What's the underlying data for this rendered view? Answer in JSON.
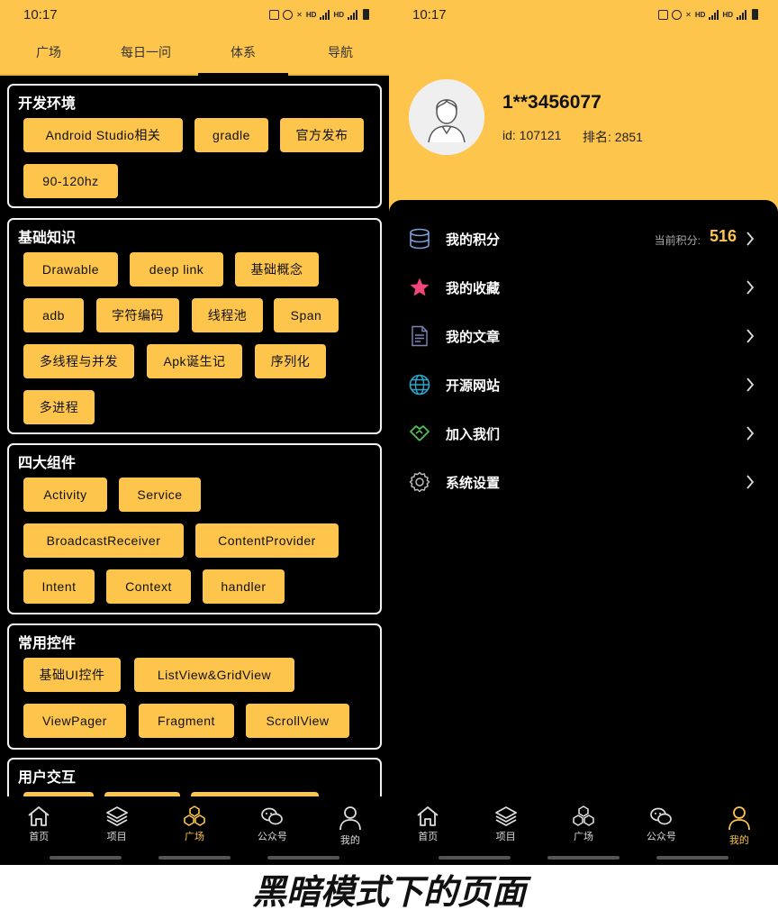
{
  "left_phone": {
    "status": {
      "time": "10:17"
    },
    "tabs": [
      "广场",
      "每日一问",
      "体系",
      "导航"
    ],
    "active_tab": "体系",
    "sections": [
      {
        "title": "开发环境",
        "chips": [
          "Android Studio相关",
          "gradle",
          "官方发布",
          "90-120hz"
        ]
      },
      {
        "title": "基础知识",
        "chips": [
          "Drawable",
          "deep link",
          "基础概念",
          "adb",
          "字符编码",
          "线程池",
          "Span",
          "多线程与并发",
          "Apk诞生记",
          "序列化",
          "多进程"
        ]
      },
      {
        "title": "四大组件",
        "chips": [
          "Activity",
          "Service",
          "BroadcastReceiver",
          "ContentProvider",
          "Intent",
          "Context",
          "handler"
        ]
      },
      {
        "title": "常用控件",
        "chips": [
          "基础UI控件",
          "ListView&GridView",
          "ViewPager",
          "Fragment",
          "ScrollView"
        ]
      },
      {
        "title": "用户交互",
        "chips": []
      }
    ],
    "bottom_nav": [
      {
        "label": "首页",
        "icon": "home-icon"
      },
      {
        "label": "项目",
        "icon": "layers-icon"
      },
      {
        "label": "广场",
        "icon": "cubes-icon"
      },
      {
        "label": "公众号",
        "icon": "wechat-icon"
      },
      {
        "label": "我的",
        "icon": "person-icon"
      }
    ],
    "active_nav": "广场"
  },
  "right_phone": {
    "status": {
      "time": "10:17"
    },
    "profile": {
      "username": "1**3456077",
      "id_text": "id: 107121",
      "rank_text": "排名: 2851"
    },
    "menu": [
      {
        "label": "我的积分",
        "icon": "database-icon",
        "points_label": "当前积分:",
        "points_value": "516"
      },
      {
        "label": "我的收藏",
        "icon": "star-icon"
      },
      {
        "label": "我的文章",
        "icon": "document-icon"
      },
      {
        "label": "开源网站",
        "icon": "globe-icon"
      },
      {
        "label": "加入我们",
        "icon": "handshake-icon"
      },
      {
        "label": "系统设置",
        "icon": "gear-icon"
      }
    ],
    "bottom_nav": [
      {
        "label": "首页",
        "icon": "home-icon"
      },
      {
        "label": "项目",
        "icon": "layers-icon"
      },
      {
        "label": "广场",
        "icon": "cubes-icon"
      },
      {
        "label": "公众号",
        "icon": "wechat-icon"
      },
      {
        "label": "我的",
        "icon": "person-icon"
      }
    ],
    "active_nav": "我的"
  },
  "caption": "黑暗模式下的页面",
  "colors": {
    "accent": "#FDC54B",
    "background": "#000000",
    "star": "#F0467A",
    "globe": "#2AA7C9",
    "handshake": "#4FC15A",
    "doc": "#7A86B8",
    "db": "#7BA0D6"
  }
}
